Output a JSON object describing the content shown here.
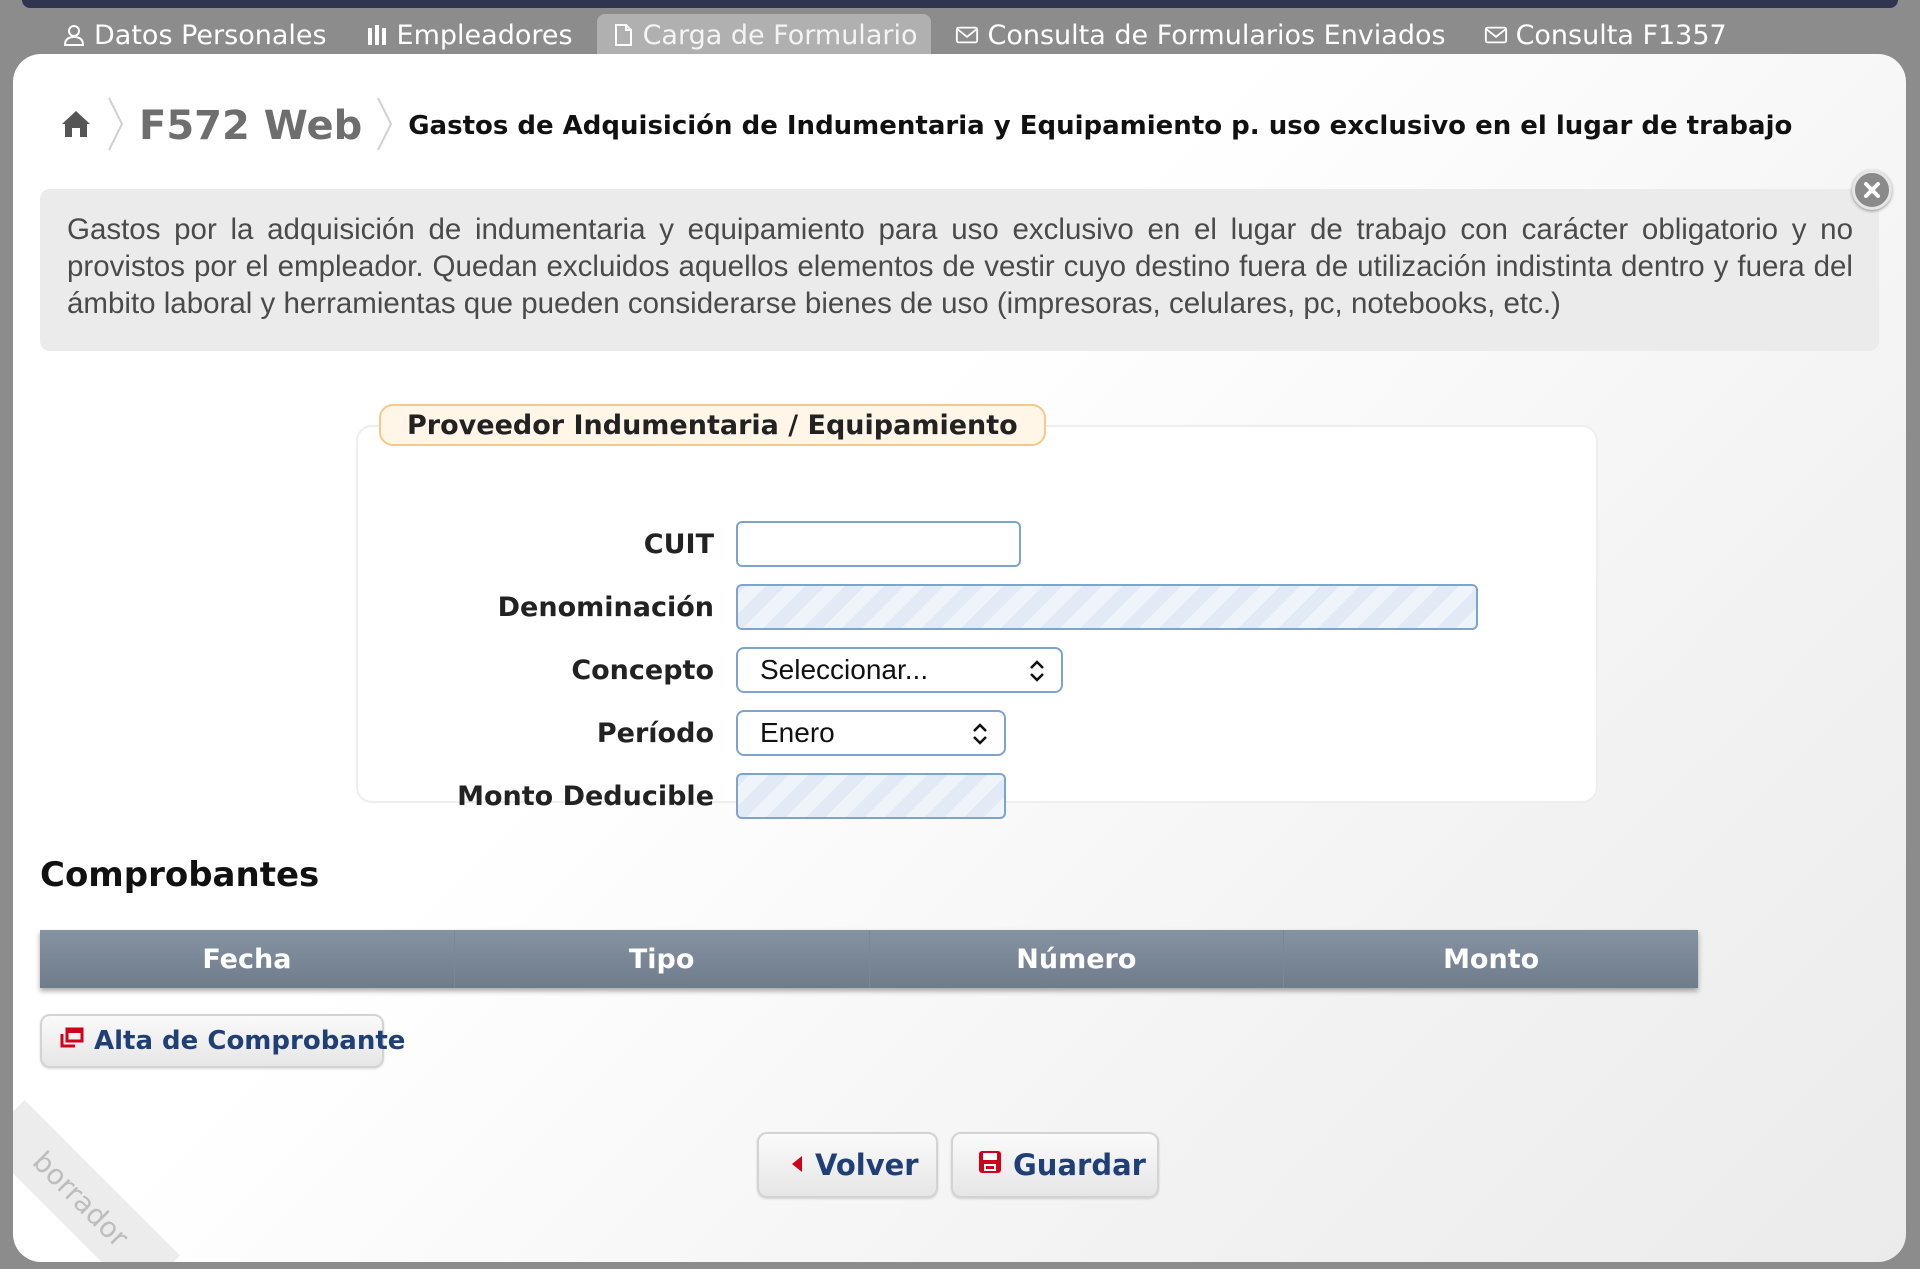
{
  "tabs": [
    {
      "label": "Datos Personales",
      "icon": "user-icon",
      "active": false
    },
    {
      "label": "Empleadores",
      "icon": "building-icon",
      "active": false
    },
    {
      "label": "Carga de Formulario",
      "icon": "document-icon",
      "active": true
    },
    {
      "label": "Consulta de Formularios Enviados",
      "icon": "envelope-icon",
      "active": false
    },
    {
      "label": "Consulta F1357",
      "icon": "envelope-icon",
      "active": false
    }
  ],
  "breadcrumb": {
    "app": "F572 Web",
    "page": "Gastos de Adquisición de Indumentaria y Equipamiento p. uso exclusivo en el lugar de trabajo"
  },
  "info_text": "Gastos por la adquisición de indumentaria y equipamiento para uso exclusivo en el lugar de trabajo con carácter obligatorio y no provistos por el empleador. Quedan excluidos aquellos elementos de vestir cuyo destino fuera de utilización indistinta dentro y fuera del ámbito laboral y herramientas que pueden considerarse bienes de uso (impresoras, celulares, pc, notebooks, etc.)",
  "form": {
    "legend": "Proveedor Indumentaria / Equipamiento",
    "cuit_label": "CUIT",
    "cuit_value": "",
    "denominacion_label": "Denominación",
    "denominacion_value": "",
    "concepto_label": "Concepto",
    "concepto_value": "Seleccionar...",
    "periodo_label": "Período",
    "periodo_value": "Enero",
    "monto_label": "Monto Deducible",
    "monto_value": ""
  },
  "comprobantes": {
    "title": "Comprobantes",
    "columns": [
      "Fecha",
      "Tipo",
      "Número",
      "Monto"
    ],
    "add_label": "Alta de Comprobante"
  },
  "actions": {
    "back_label": "Volver",
    "save_label": "Guardar"
  },
  "watermark": "borrador",
  "colors": {
    "accent_text": "#1f3f75",
    "table_header": "#7a8797",
    "legend_border": "#f5c98a",
    "danger_icon": "#d0021b"
  }
}
